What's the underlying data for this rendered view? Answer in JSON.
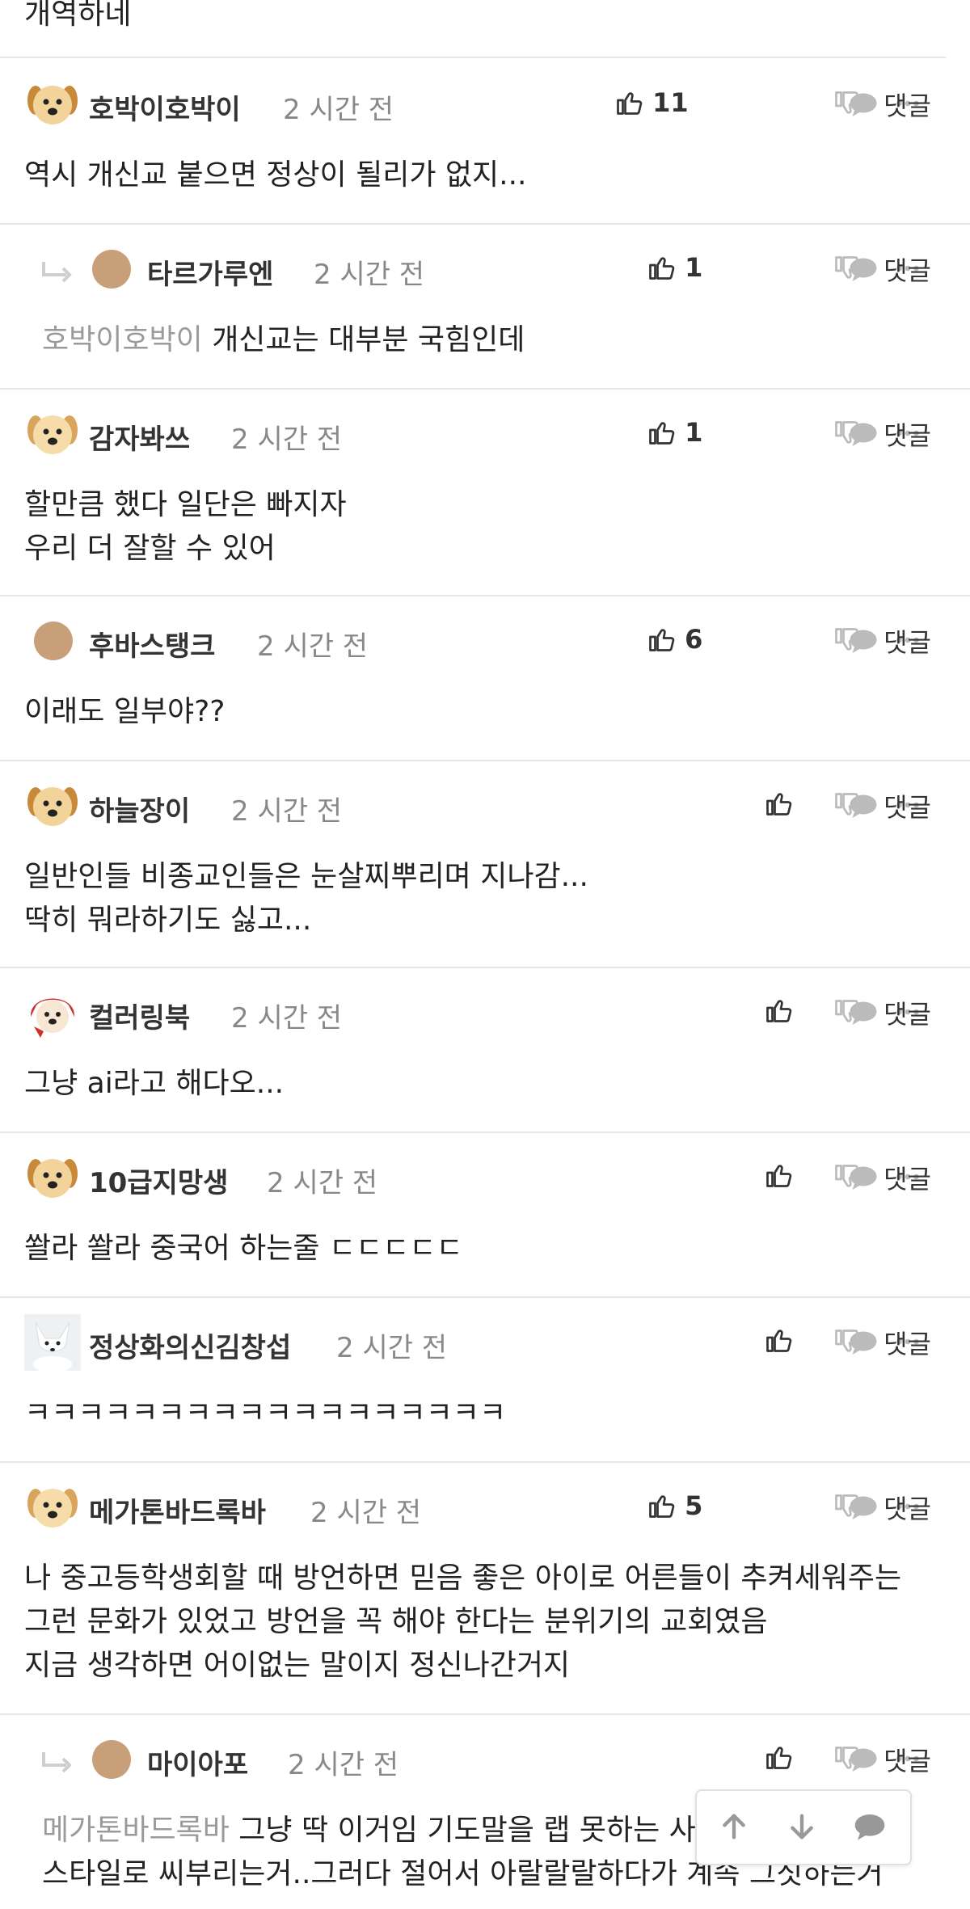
{
  "top_fragment": "개역하네",
  "reply_label": "댓글",
  "comments": [
    {
      "nick": "호박이호박이",
      "time": "2 시간 전",
      "likes": "11",
      "avatar": "puppy-avatar",
      "lines": [
        "역시 개신교 붙으면 정상이 될리가 없지..."
      ]
    },
    {
      "nick": "타르가루엔",
      "time": "2 시간 전",
      "likes": "1",
      "avatar": "brown-circle-avatar",
      "mention": "호박이호박이",
      "lines": [
        "개신교는 대부분 국힘인데"
      ]
    },
    {
      "nick": "감자봐쓰",
      "time": "2 시간 전",
      "likes": "1",
      "avatar": "puppy-avatar",
      "lines": [
        "할만큼 했다 일단은 빠지자",
        "우리 더 잘할 수 있어"
      ]
    },
    {
      "nick": "후바스탱크",
      "time": "2 시간 전",
      "likes": "6",
      "avatar": "brown-circle-avatar",
      "lines": [
        "이래도 일부야??"
      ]
    },
    {
      "nick": "하늘장이",
      "time": "2 시간 전",
      "likes": "",
      "avatar": "puppy-avatar",
      "lines": [
        "일반인들 비종교인들은 눈살찌뿌리며 지나감...",
        "딱히 뭐라하기도 싫고..."
      ]
    },
    {
      "nick": "컬러링북",
      "time": "2 시간 전",
      "likes": "",
      "avatar": "red-hood-puppy-avatar",
      "lines": [
        "그냥 ai라고 해다오..."
      ]
    },
    {
      "nick": "10급지망생",
      "time": "2 시간 전",
      "likes": "",
      "avatar": "puppy-avatar",
      "lines": [
        "쏼라 쏼라 중국어 하는줄 ㄷㄷㄷㄷㄷ"
      ]
    },
    {
      "nick": "정상화의신김창섭",
      "time": "2 시간 전",
      "likes": "",
      "avatar": "white-fox-avatar",
      "lines": [
        "ㅋㅋㅋㅋㅋㅋㅋㅋㅋㅋㅋㅋㅋㅋㅋㅋㅋㅋ"
      ]
    },
    {
      "nick": "메가톤바드록바",
      "time": "2 시간 전",
      "likes": "5",
      "avatar": "puppy-avatar",
      "lines": [
        "나 중고등학생회할 때 방언하면 믿음 좋은 아이로 어른들이 추켜세워주는",
        "그런 문화가 있었고 방언을 꼭 해야 한다는 분위기의 교회였음",
        "지금 생각하면 어이없는 말이지 정신나간거지"
      ]
    },
    {
      "nick": "마이아포",
      "time": "2 시간 전",
      "likes": "",
      "avatar": "brown-circle-avatar",
      "mention": "메가톤바드록바",
      "lines": [
        "그냥 딱 이거임 기도말을 랩 못하는 사람이",
        "스타일로 씨부리는거..그러다 절어서 아랄랄랄하다가 계속 그짓하는거"
      ]
    }
  ],
  "colors": {
    "divider": "#e6e6e6",
    "muted": "#888888",
    "mention": "#9a9a9a",
    "icon_light": "#bbbbbb"
  }
}
